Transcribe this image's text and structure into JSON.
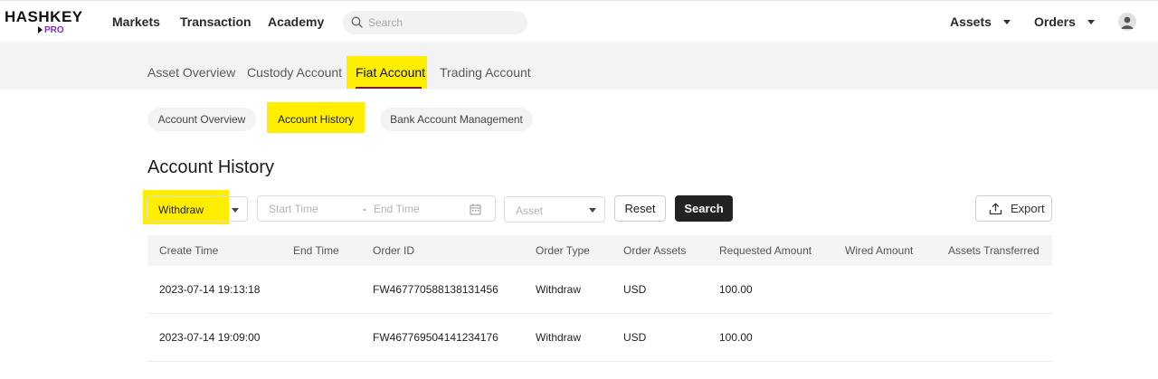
{
  "brand": {
    "name": "HASHKEY",
    "sub": "PRO",
    "accent": "#7b2fbe",
    "highlight": "#ffee00"
  },
  "nav": {
    "links": [
      "Markets",
      "Transaction",
      "Academy"
    ],
    "search_placeholder": "Search",
    "assets_label": "Assets",
    "orders_label": "Orders"
  },
  "account_tabs": [
    "Asset Overview",
    "Custody Account",
    "Fiat Account",
    "Trading Account"
  ],
  "active_account_tab": "Fiat Account",
  "sub_tabs": [
    "Account Overview",
    "Account History",
    "Bank Account Management"
  ],
  "active_sub_tab": "Account History",
  "page_title": "Account History",
  "filters": {
    "type_value": "Withdraw",
    "start_placeholder": "Start Time",
    "separator": "-",
    "end_placeholder": "End Time",
    "asset_placeholder": "Asset",
    "reset_label": "Reset",
    "search_label": "Search",
    "export_label": "Export"
  },
  "table": {
    "columns": [
      "Create Time",
      "End Time",
      "Order ID",
      "Order Type",
      "Order Assets",
      "Requested Amount",
      "Wired Amount",
      "Assets Transferred"
    ],
    "rows": [
      {
        "create_time": "2023-07-14 19:13:18",
        "end_time": "",
        "order_id": "FW467770588138131456",
        "order_type": "Withdraw",
        "order_assets": "USD",
        "requested_amount": "100.00",
        "wired_amount": "",
        "assets_transferred": ""
      },
      {
        "create_time": "2023-07-14 19:09:00",
        "end_time": "",
        "order_id": "FW467769504141234176",
        "order_type": "Withdraw",
        "order_assets": "USD",
        "requested_amount": "100.00",
        "wired_amount": "",
        "assets_transferred": ""
      }
    ]
  }
}
